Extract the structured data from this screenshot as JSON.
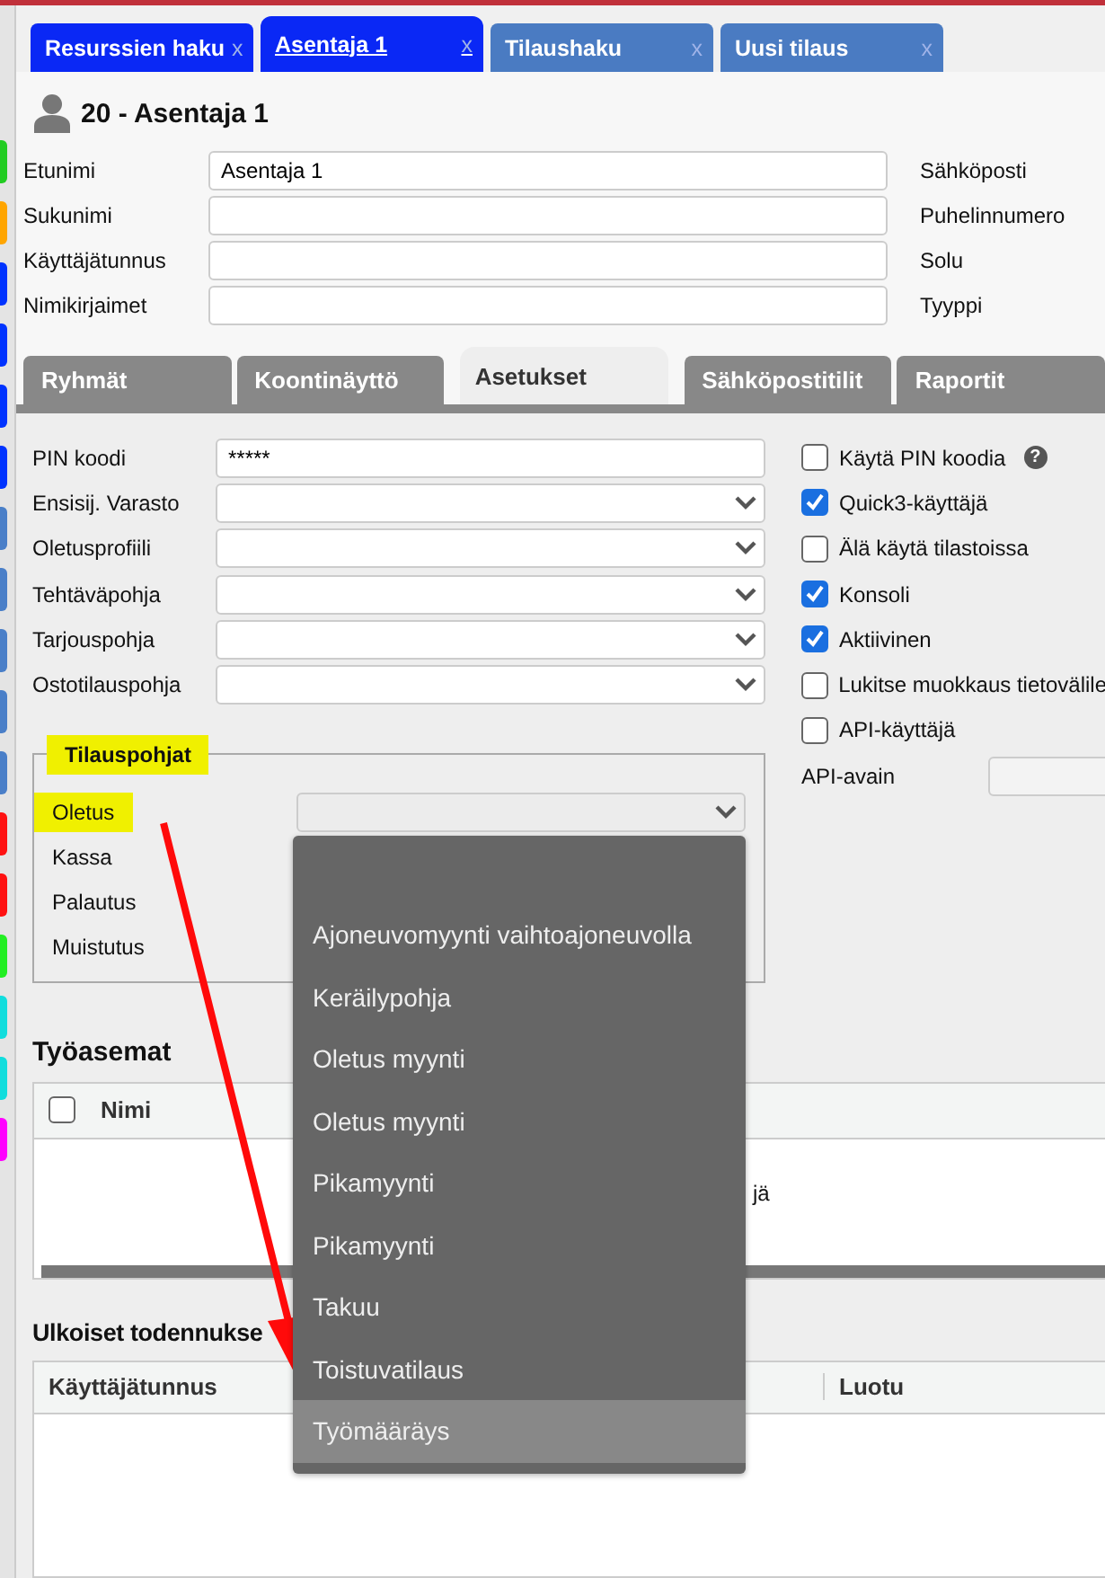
{
  "sidebar": {
    "marks": [
      {
        "color": "#22cc22"
      },
      {
        "color": "#ffa500"
      },
      {
        "color": "#0033ff"
      },
      {
        "color": "#0033ff"
      },
      {
        "color": "#0033ff"
      },
      {
        "color": "#0033ff"
      },
      {
        "color": "#4a7fc8"
      },
      {
        "color": "#4a7fc8"
      },
      {
        "color": "#4a7fc8"
      },
      {
        "color": "#4a7fc8"
      },
      {
        "color": "#4a7fc8"
      },
      {
        "color": "#ff1111"
      },
      {
        "color": "#ff1111"
      },
      {
        "color": "#22ee22"
      },
      {
        "color": "#11dddd"
      },
      {
        "color": "#11dddd"
      },
      {
        "color": "#ff00ff"
      }
    ]
  },
  "tabs": [
    {
      "label": "Resurssien haku",
      "close": "x",
      "selected": false,
      "color": "#0a28f5"
    },
    {
      "label": "Asentaja 1",
      "close": "x",
      "selected": true,
      "color": "#0a28f5"
    },
    {
      "label": "Tilaushaku",
      "close": "x",
      "selected": false,
      "color": "#4a7bc2"
    },
    {
      "label": "Uusi tilaus",
      "close": "x",
      "selected": false,
      "color": "#4a7bc2"
    }
  ],
  "header": {
    "title": "20 - Asentaja 1"
  },
  "fields": [
    {
      "label": "Etunimi",
      "value": "Asentaja 1"
    },
    {
      "label": "Sukunimi"
    },
    {
      "label": "Käyttäjätunnus"
    },
    {
      "label": "Nimikirjaimet"
    }
  ],
  "right_fields": [
    {
      "label": "Sähköposti"
    },
    {
      "label": "Puhelinnumero"
    },
    {
      "label": "Solu"
    },
    {
      "label": "Tyyppi"
    }
  ],
  "subtabs": [
    {
      "label": "Ryhmät",
      "selected": false
    },
    {
      "label": "Koontinäyttö",
      "selected": false
    },
    {
      "label": "Asetukset",
      "selected": true
    },
    {
      "label": "Sähköpostitilit",
      "selected": false
    },
    {
      "label": "Raportit",
      "selected": false
    }
  ],
  "settings": {
    "fields": [
      {
        "label": "PIN koodi",
        "kind": "text",
        "value": "*****"
      },
      {
        "label": "Ensisij. Varasto",
        "kind": "select"
      },
      {
        "label": "Oletusprofiili",
        "kind": "select"
      },
      {
        "label": "Tehtäväpohja",
        "kind": "select"
      },
      {
        "label": "Tarjouspohja",
        "kind": "select"
      },
      {
        "label": "Ostotilauspohja",
        "kind": "select"
      }
    ],
    "checkboxes": [
      {
        "label": "Käytä PIN koodia",
        "checked": false,
        "help": "?"
      },
      {
        "label": "Quick3-käyttäjä",
        "checked": true
      },
      {
        "label": "Älä käytä tilastoissa",
        "checked": false
      },
      {
        "label": "Konsoli",
        "checked": true
      },
      {
        "label": "Aktiivinen",
        "checked": true
      },
      {
        "label": "Lukitse muokkaus tietovälile",
        "checked": false
      },
      {
        "label": "API-käyttäjä",
        "checked": false
      }
    ],
    "api_key": {
      "label": "API-avain"
    }
  },
  "order_templates": {
    "legend": "Tilauspohjat",
    "rows": [
      {
        "label": "Oletus",
        "highlighted": true
      },
      {
        "label": "Kassa",
        "highlighted": false
      },
      {
        "label": "Palautus",
        "highlighted": false
      },
      {
        "label": "Muistutus",
        "highlighted": false
      }
    ]
  },
  "dropdown": {
    "items": [
      {
        "label": "Ajoneuvomyynti vaihtoajoneuvolla",
        "selected": false
      },
      {
        "label": "Keräilypohja",
        "selected": false
      },
      {
        "label": "Oletus myynti",
        "selected": false
      },
      {
        "label": "Oletus myynti",
        "selected": false
      },
      {
        "label": "Pikamyynti",
        "selected": false
      },
      {
        "label": "Pikamyynti",
        "selected": false
      },
      {
        "label": "Takuu",
        "selected": false
      },
      {
        "label": "Toistuvatilaus",
        "selected": false
      },
      {
        "label": "Työmääräys",
        "selected": true
      }
    ]
  },
  "workstations": {
    "title": "Työasemat",
    "select_all": {
      "checked": false
    },
    "columns": [
      "Nimi"
    ],
    "rows": [
      {
        "cell": "jä"
      }
    ]
  },
  "external_auth": {
    "title": "Ulkoiset todennukse",
    "columns": [
      "Käyttäjätunnus",
      "Luotu"
    ]
  }
}
